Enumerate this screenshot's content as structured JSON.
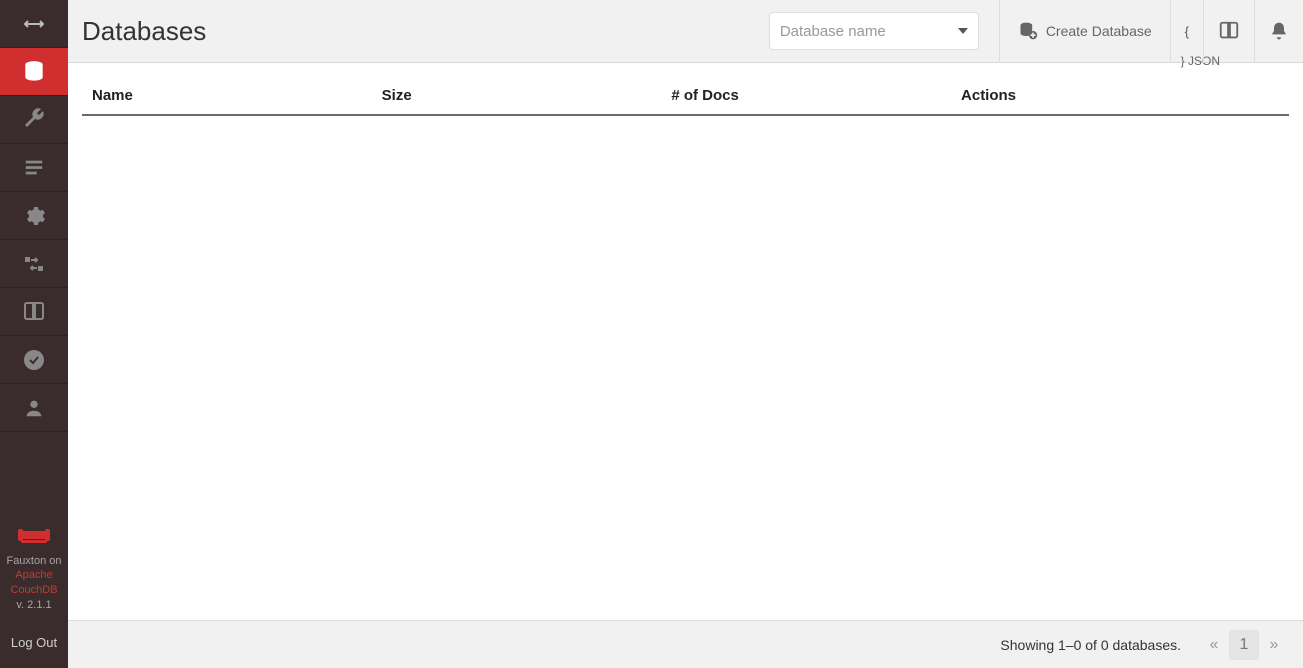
{
  "sidebar": {
    "brand_line1": "Fauxton on",
    "brand_link1": "Apache",
    "brand_link2": "CouchDB",
    "version": "v. 2.1.1",
    "logout": "Log Out"
  },
  "header": {
    "title": "Databases",
    "search_placeholder": "Database name",
    "create_label": "Create Database",
    "json_top": "{",
    "json_bottom": "} JSON"
  },
  "table": {
    "columns": {
      "name": "Name",
      "size": "Size",
      "docs": "# of Docs",
      "actions": "Actions"
    },
    "rows": []
  },
  "footer": {
    "status": "Showing 1–0 of 0 databases.",
    "page": "1",
    "prev": "«",
    "next": "»"
  }
}
